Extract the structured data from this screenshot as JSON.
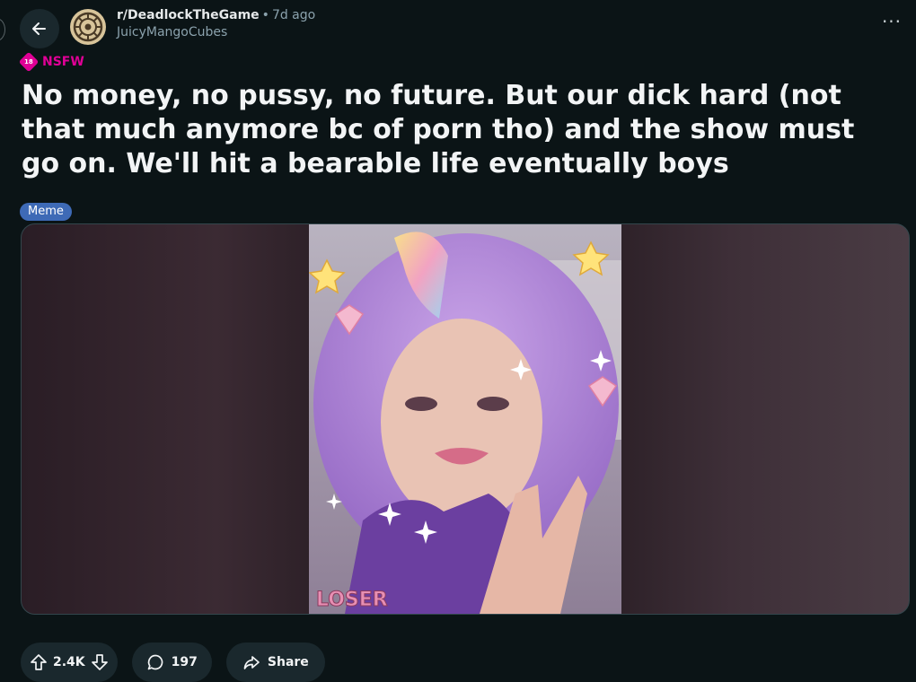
{
  "post": {
    "subreddit": "r/DeadlockTheGame",
    "separator": "•",
    "time_ago": "7d ago",
    "author": "JuicyMangoCubes",
    "nsfw_badge_number": "18",
    "nsfw_label": "NSFW",
    "title": "No money, no pussy, no future. But our dick hard (not that much anymore bc of porn tho) and the show must go on. We'll hit a bearable life eventually boys",
    "flair": "Meme",
    "image_overlay_text": "LOSER"
  },
  "actions": {
    "upvote_count": "2.4K",
    "comment_count": "197",
    "share_label": "Share"
  },
  "colors": {
    "background": "#0b1416",
    "nsfw": "#e00096",
    "flair": "#3e6ab6",
    "pill": "#1a282d"
  },
  "icons": [
    "back-arrow-icon",
    "subreddit-icon",
    "more-options-icon",
    "nsfw-icon",
    "upvote-icon",
    "downvote-icon",
    "comment-icon",
    "share-icon"
  ]
}
